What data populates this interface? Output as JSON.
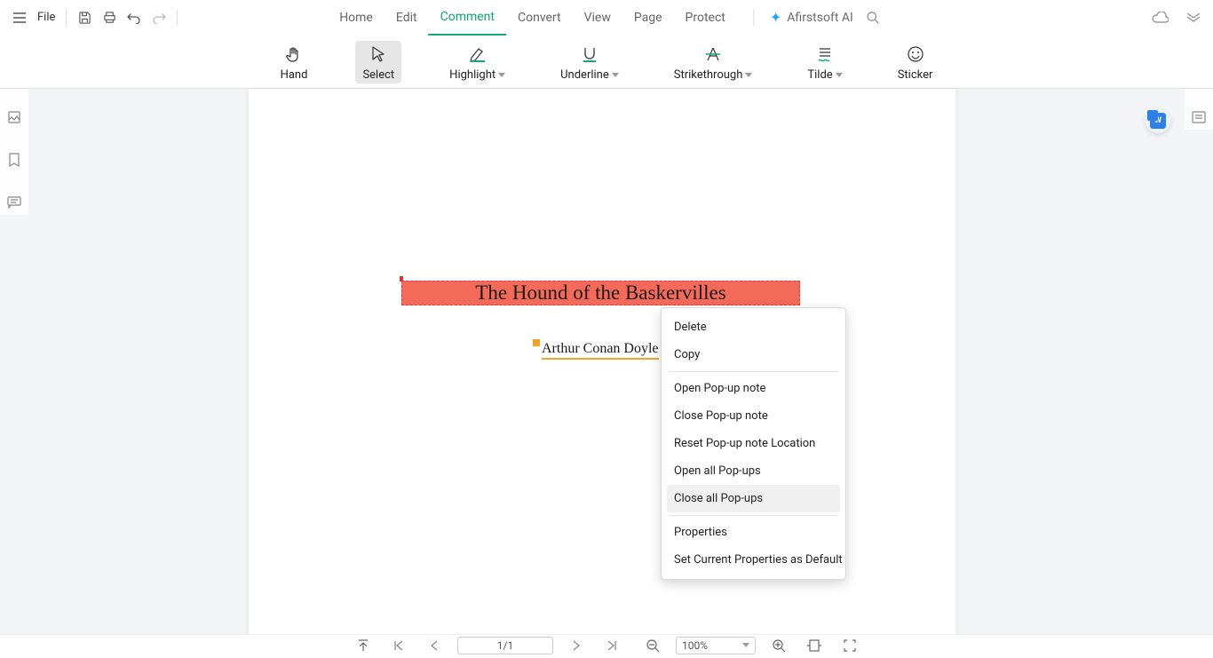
{
  "topbar": {
    "file_label": "File",
    "tabs": [
      "Home",
      "Edit",
      "Comment",
      "Convert",
      "View",
      "Page",
      "Protect"
    ],
    "active_tab": "Comment",
    "ai_label": "Afirstsoft AI"
  },
  "ribbon": {
    "hand": "Hand",
    "select": "Select",
    "highlight": "Highlight",
    "underline": "Underline",
    "strikethrough": "Strikethrough",
    "tilde": "Tilde",
    "sticker": "Sticker"
  },
  "document": {
    "title": "The Hound of the Baskervilles",
    "author": "Arthur Conan Doyle"
  },
  "context_menu": {
    "items": [
      "Delete",
      "Copy",
      "Open Pop-up note",
      "Close Pop-up note",
      "Reset Pop-up note Location",
      "Open all Pop-ups",
      "Close all Pop-ups",
      "Properties",
      "Set Current Properties as Default"
    ],
    "hovered": "Close all Pop-ups"
  },
  "statusbar": {
    "page": "1/1",
    "zoom": "100%"
  }
}
